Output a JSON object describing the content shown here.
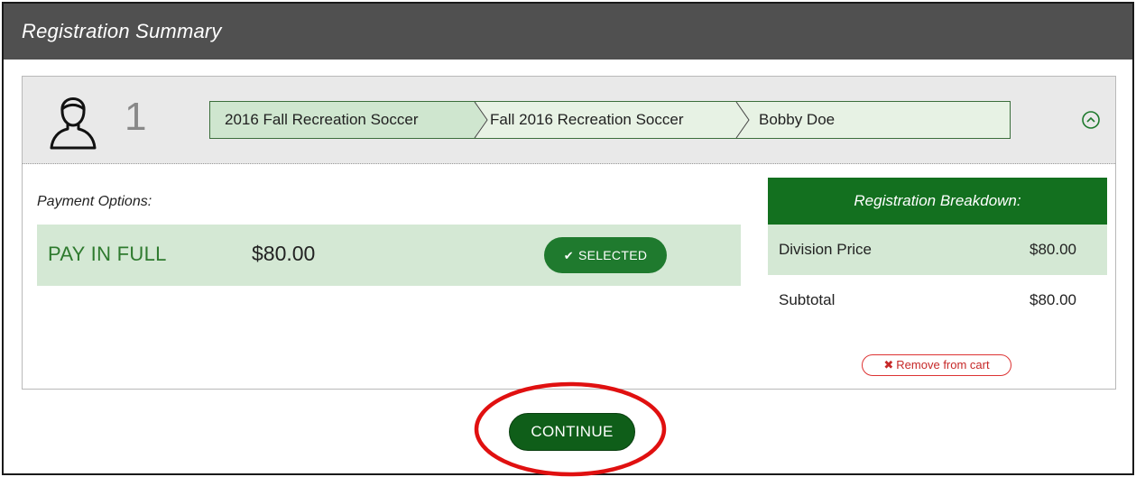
{
  "header": {
    "title": "Registration Summary"
  },
  "registration": {
    "number": "1",
    "breadcrumbs": [
      "2016 Fall Recreation Soccer",
      "Fall 2016 Recreation Soccer",
      "Bobby Doe"
    ],
    "collapse_icon": "chevron-up-circle-icon",
    "avatar_icon": "person-icon"
  },
  "payment": {
    "label": "Payment Options:",
    "option_name": "PAY IN FULL",
    "option_amount": "$80.00",
    "selected_label": "SELECTED"
  },
  "breakdown": {
    "title": "Registration Breakdown:",
    "rows": [
      {
        "label": "Division Price",
        "value": "$80.00"
      },
      {
        "label": "Subtotal",
        "value": "$80.00"
      }
    ],
    "remove_label": "Remove from cart"
  },
  "footer": {
    "continue_label": "CONTINUE"
  },
  "colors": {
    "title_bar": "#505050",
    "accent_green": "#13701f",
    "light_green": "#d4e8d4",
    "highlight": "#e01010",
    "remove_red": "#c62828"
  }
}
